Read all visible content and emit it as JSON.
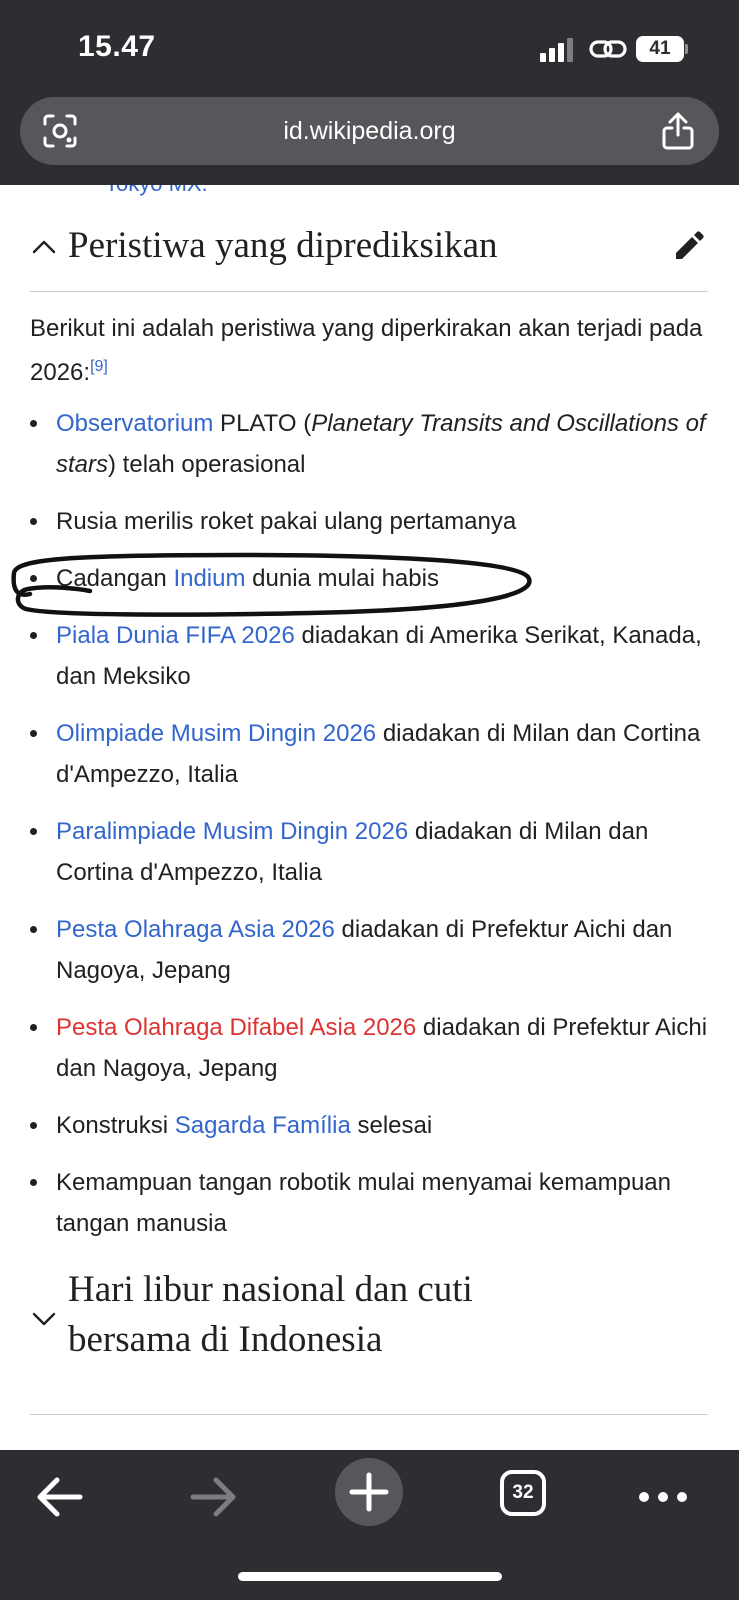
{
  "status_bar": {
    "time": "15.47",
    "battery": "41"
  },
  "address_bar": {
    "url": "id.wikipedia.org"
  },
  "previous_section": {
    "tail_link": "Tokyo MX",
    "tail_punct": "."
  },
  "section_events": {
    "title": "Peristiwa yang diprediksikan",
    "intro": "Berikut ini adalah peristiwa yang diperkirakan akan terjadi pada 2026:",
    "ref": "[9]",
    "items": [
      {
        "link": "Observatorium",
        "t1": " PLATO (",
        "italic": "Planetary Transits and Oscillations of stars",
        "t2": ") telah operasional"
      },
      {
        "text": "Rusia merilis roket pakai ulang pertamanya"
      },
      {
        "pre": "Cadangan ",
        "link": "Indium",
        "post": " dunia mulai habis"
      },
      {
        "link": "Piala Dunia FIFA 2026",
        "post": " diadakan di Amerika Serikat, Kanada, dan Meksiko"
      },
      {
        "link": "Olimpiade Musim Dingin 2026",
        "post": " diadakan di Milan dan Cortina d'Ampezzo, Italia"
      },
      {
        "link": "Paralimpiade Musim Dingin 2026",
        "post": " diadakan di Milan dan Cortina d'Ampezzo, Italia"
      },
      {
        "link": "Pesta Olahraga Asia 2026",
        "post": " diadakan di Prefektur Aichi dan Nagoya, Jepang"
      },
      {
        "link": "Pesta Olahraga Difabel Asia 2026",
        "post": " diadakan di Prefektur Aichi dan Nagoya, Jepang"
      },
      {
        "pre": "Konstruksi ",
        "link": "Sagarda Família",
        "post": " selesai"
      },
      {
        "text": "Kemampuan tangan robotik mulai menyamai kemampuan tangan manusia"
      }
    ]
  },
  "section_holidays": {
    "title_line1": "Hari libur nasional dan cuti",
    "title_line2": "bersama di Indonesia"
  },
  "toolbar": {
    "tab_count": "32"
  },
  "colors": {
    "link": "#3366cc",
    "redlink": "#dd3333",
    "chrome": "#2c2e31"
  }
}
